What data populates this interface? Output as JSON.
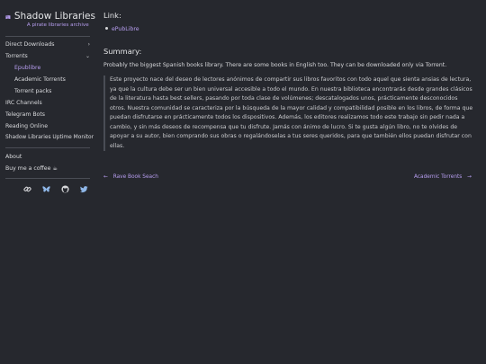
{
  "brand": {
    "title": "Shadow Libraries",
    "subtitle": "A pirate libraries archive"
  },
  "nav": {
    "direct_downloads": "Direct Downloads",
    "torrents": "Torrents",
    "epublibre": "Epublibre",
    "academic_torrents": "Academic Torrents",
    "torrent_packs": "Torrent packs",
    "irc_channels": "IRC Channels",
    "telegram_bots": "Telegram Bots",
    "reading_online": "Reading Online",
    "uptime_monitor": "Shadow Libraries Uptime Monitor",
    "about": "About",
    "coffee": "Buy me a coffee ☕"
  },
  "colors": {
    "accent": "#b79ef0",
    "background": "#26282e",
    "text": "#d6d7da"
  },
  "socials": [
    "link-icon",
    "bluesky-icon",
    "github-icon",
    "twitter-icon"
  ],
  "main": {
    "link_heading": "Link:",
    "link_text": "ePubLibre",
    "summary_heading": "Summary:",
    "intro": "Probably the biggest Spanish books library. There are some books in English too. They can be downloaded only via Torrent.",
    "quote": "Este proyecto nace del deseo de lectores anónimos de compartir sus libros favoritos con todo aquel que sienta ansias de lectura, ya que la cultura debe ser un bien universal accesible a todo el mundo. En nuestra biblioteca encontrarás desde grandes clásicos de la literatura hasta best sellers, pasando por toda clase de volúmenes; descatalogados unos, prácticamente desconocidos otros. Nuestra comunidad se caracteriza por la búsqueda de la mayor calidad y compatibilidad posible en los libros, de forma que puedan disfrutarse en prácticamente todos los dispositivos. Además, los editores realizamos todo este trabajo sin pedir nada a cambio, y sin más deseos de recompensa que tu disfrute. Jamás con ánimo de lucro. Si te gusta algún libro, no te olvides de apoyar a su autor, bien comprando sus obras o regalándoselas a tus seres queridos, para que también ellos puedan disfrutar con ellas."
  },
  "pager": {
    "prev_label": "Rave Book Seach",
    "next_label": "Academic Torrents"
  }
}
